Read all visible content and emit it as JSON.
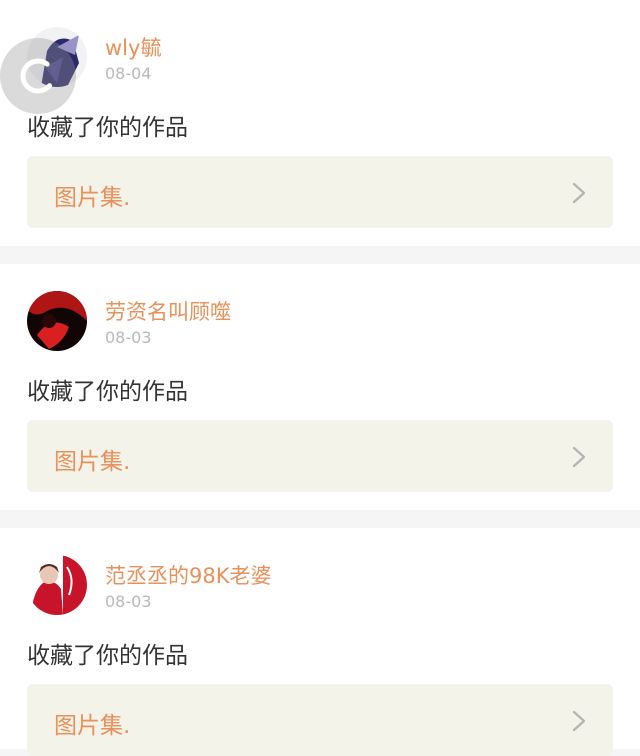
{
  "notifications": [
    {
      "username": "wly毓",
      "date": "08-04",
      "action": "收藏了你的作品",
      "collection_title": "图片集.",
      "avatar_colors": [
        "#2a2a6a",
        "#9a93c8"
      ]
    },
    {
      "username": "劳资名叫顾噬",
      "date": "08-03",
      "action": "收藏了你的作品",
      "collection_title": "图片集.",
      "avatar_colors": [
        "#b01515",
        "#120505"
      ]
    },
    {
      "username": "范丞丞的98K老婆",
      "date": "08-03",
      "action": "收藏了你的作品",
      "collection_title": "图片集.",
      "avatar_colors": [
        "#ffffff",
        "#c8142a"
      ]
    }
  ],
  "theme": {
    "accent": "#e8915a",
    "text": "#333333",
    "muted": "#b9b9b9",
    "collection_bg": "#f3f3ea",
    "divider": "#f5f5f5"
  },
  "icons": {
    "chevron": "chevron-right-icon",
    "back": "back-overlay-icon"
  }
}
